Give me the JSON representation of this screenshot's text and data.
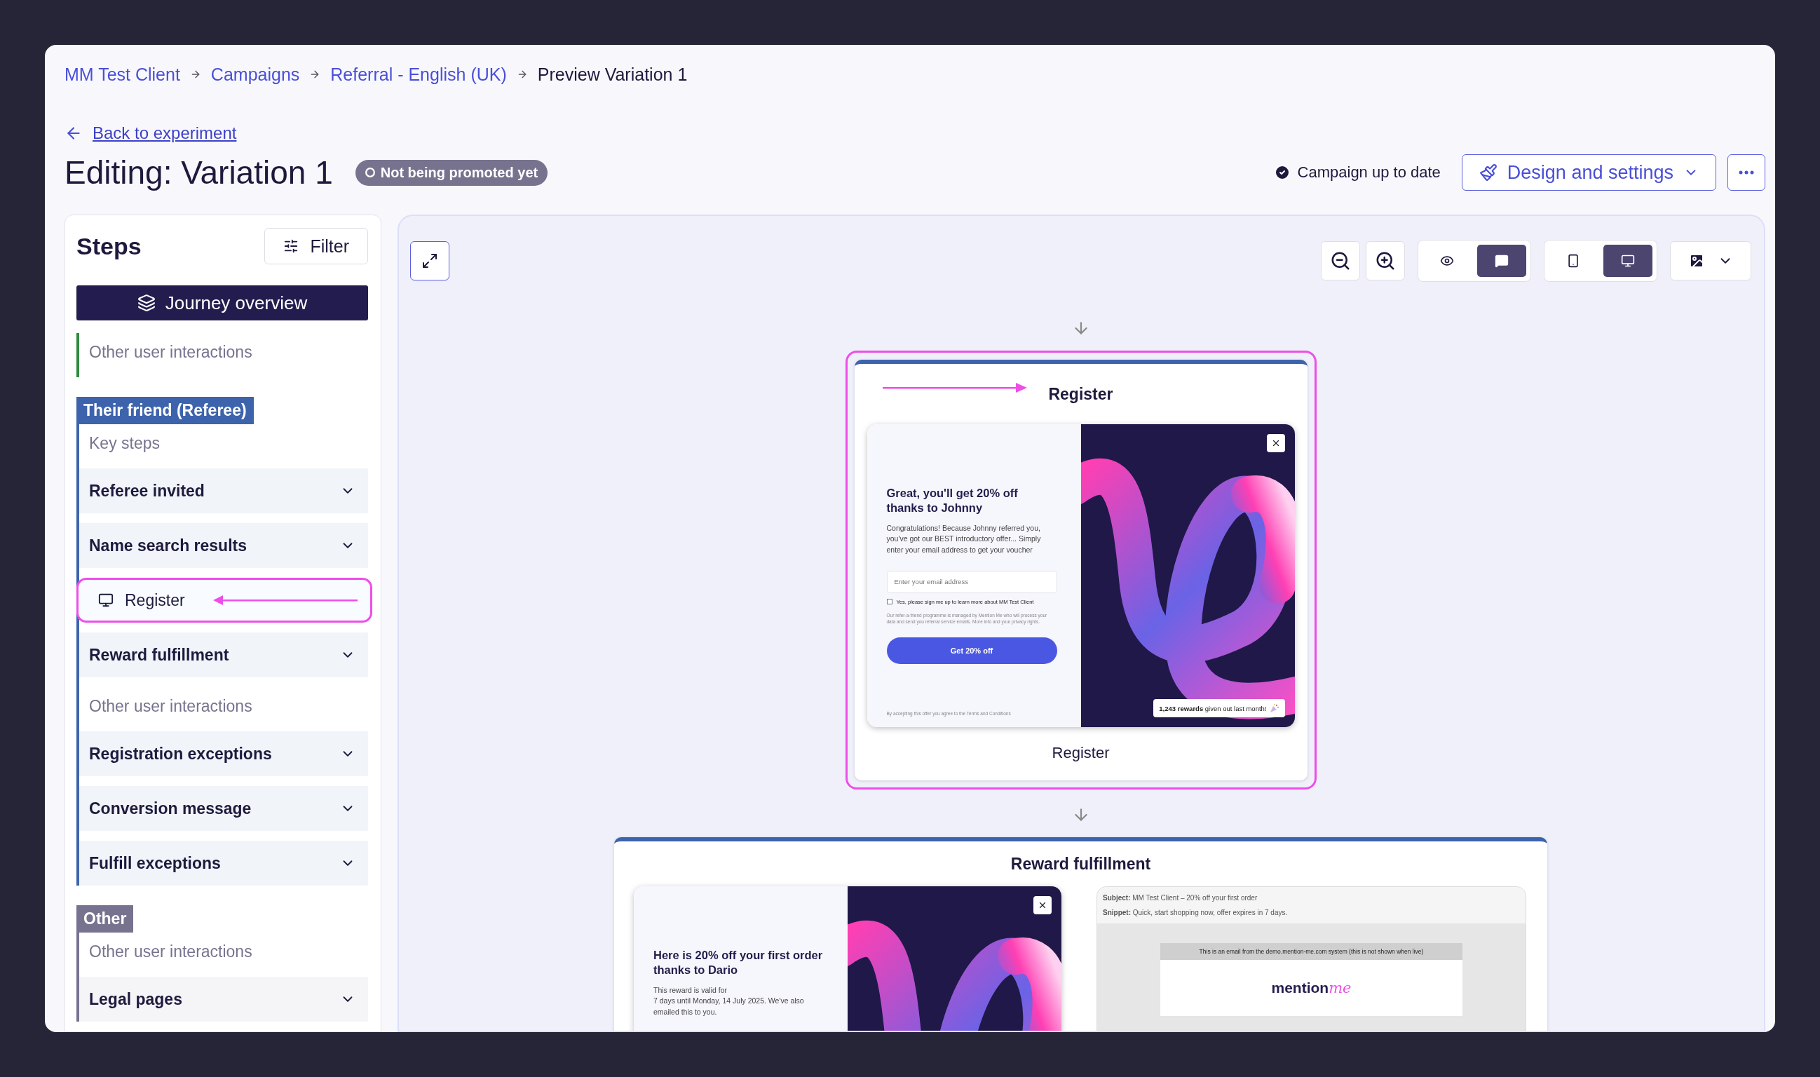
{
  "breadcrumb": [
    {
      "label": "MM Test Client",
      "link": true
    },
    {
      "label": "Campaigns",
      "link": true
    },
    {
      "label": "Referral - English (UK)",
      "link": true
    },
    {
      "label": "Preview Variation 1",
      "link": false
    }
  ],
  "back_link": "Back to experiment",
  "title": "Editing: Variation 1",
  "status_badge": "Not being promoted yet",
  "sync_status": "Campaign up to date",
  "design_button": "Design and settings",
  "steps": {
    "title": "Steps",
    "filter": "Filter",
    "overview": "Journey overview",
    "groups": [
      {
        "color": "#2e8b3e",
        "sections": [
          {
            "heading": "Other user interactions"
          }
        ]
      },
      {
        "label": "Their friend (Referee)",
        "color": "#3d63ad",
        "sections": [
          {
            "heading": "Key steps",
            "items": [
              {
                "label": "Referee invited",
                "kind": "collapsible",
                "highlighted": false
              },
              {
                "label": "Name search results",
                "kind": "collapsible",
                "highlighted": false
              },
              {
                "label": "Register",
                "kind": "step",
                "highlighted": true
              },
              {
                "label": "Reward fulfillment",
                "kind": "collapsible",
                "highlighted": false
              }
            ]
          },
          {
            "heading": "Other user interactions",
            "items": [
              {
                "label": "Registration exceptions",
                "kind": "collapsible",
                "highlighted": false
              },
              {
                "label": "Conversion message",
                "kind": "collapsible",
                "highlighted": false
              },
              {
                "label": "Fulfill exceptions",
                "kind": "collapsible",
                "highlighted": false
              }
            ]
          }
        ]
      },
      {
        "label": "Other",
        "color": "#77738f",
        "sections": [
          {
            "heading": "Other user interactions",
            "items": [
              {
                "label": "Legal pages",
                "kind": "collapsible",
                "highlighted": false
              }
            ]
          }
        ]
      }
    ]
  },
  "toolbar": {
    "view_modes": [
      {
        "kind": "eye",
        "selected": false
      },
      {
        "kind": "comment",
        "selected": true
      }
    ],
    "devices": [
      {
        "kind": "mobile",
        "selected": false
      },
      {
        "kind": "desktop",
        "selected": true
      }
    ]
  },
  "flow": [
    {
      "kind": "popup",
      "title": "Register",
      "caption": "Register",
      "highlighted": true,
      "popup": {
        "heading": "Great, you'll get 20% off thanks to Johnny",
        "body": "Congratulations! Because Johnny referred you, you've got our BEST introductory offer... Simply enter your email address to get your voucher",
        "email_placeholder": "Enter your email address",
        "consent": "Yes, please sign me up to learn more about MM Test Client",
        "consent_checked": false,
        "privacy": "Our refer-a-friend programme is managed by Mention Me who will process your data and send you referral service emails. More info and your privacy rights.",
        "button": "Get 20% off",
        "terms": "By accepting this offer you agree to the Terms and Conditions",
        "rewards_note": "**1,243 rewards** given out last month!"
      }
    },
    {
      "kind": "reward",
      "title": "Reward fulfillment",
      "highlighted": false,
      "popup": {
        "heading": "Here is 20% off your first order thanks to Dario",
        "body": "This reward is valid for\n7 days until Monday, 14 July 2025. We've also emailed this to you."
      },
      "email": {
        "subject": "**Subject:** MM Test Client – 20% off your first order",
        "snippet": "**Snippet:** Quick, start shopping now, offer expires in 7 days.",
        "notice": "This is an email from the demo.mention-me.com system (this is not shown when live)",
        "logo": {
          "text": "mention",
          "accent": "me"
        }
      }
    }
  ]
}
